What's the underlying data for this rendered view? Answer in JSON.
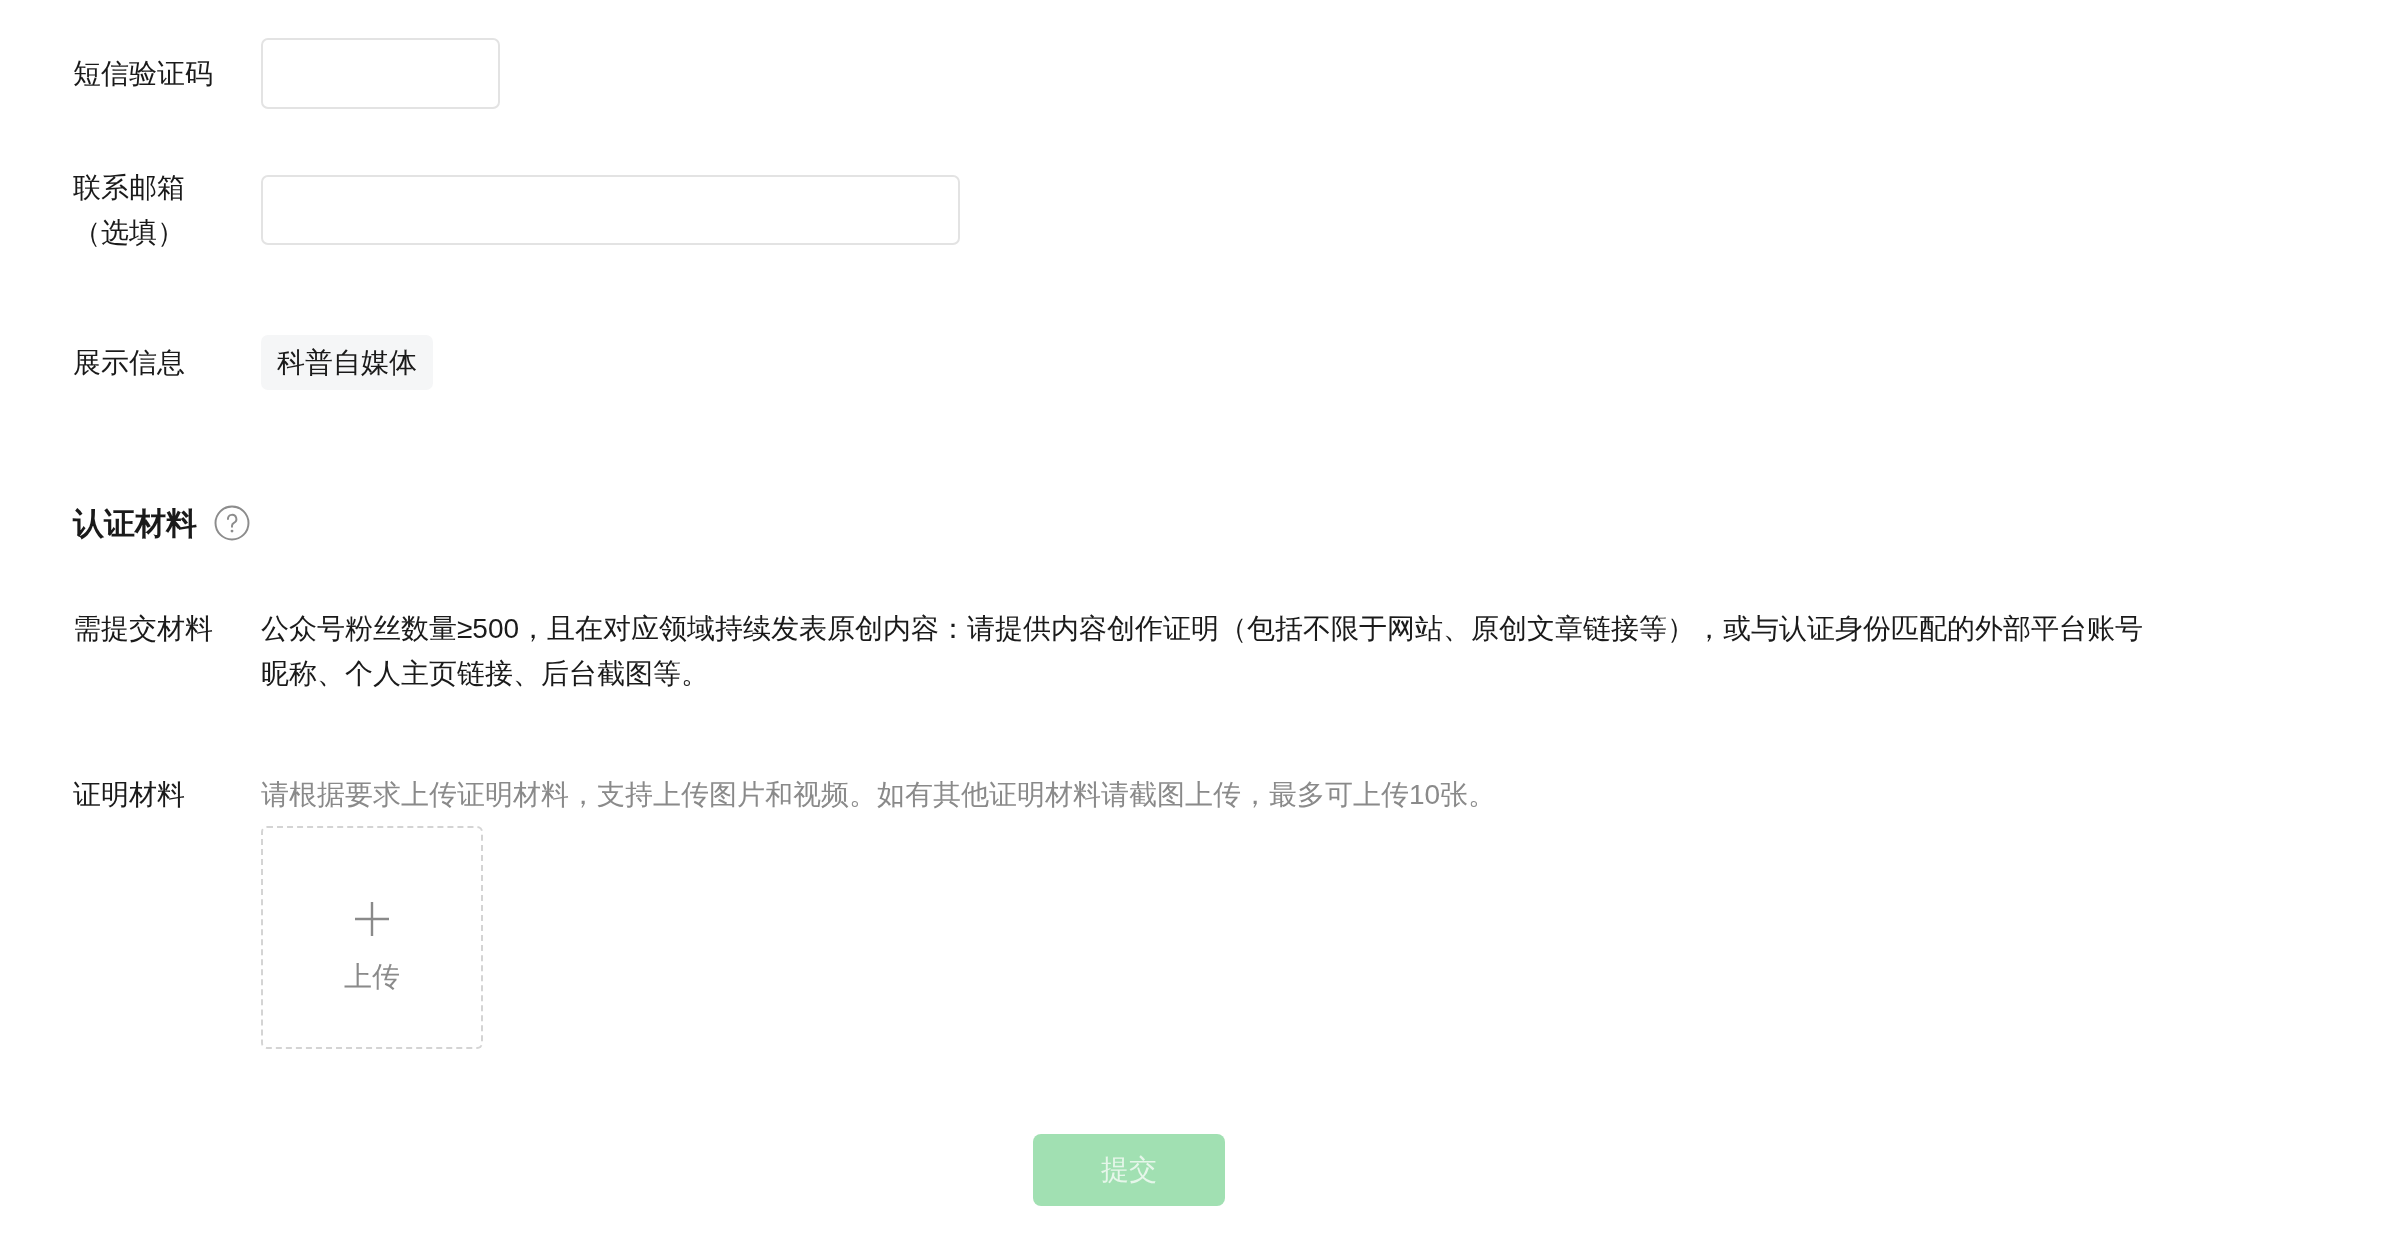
{
  "form": {
    "fields": [
      {
        "kind": "code",
        "label": "短信验证码"
      },
      {
        "kind": "text",
        "label": "联系邮箱（选填）"
      },
      {
        "kind": "tag",
        "label": "展示信息",
        "value": "科普自媒体"
      }
    ]
  },
  "certification": {
    "title": "认证材料",
    "requirements": {
      "label": "需提交材料",
      "text": "公众号粉丝数量≥500，且在对应领域持续发表原创内容：请提供内容创作证明（包括不限于网站、原创文章链接等），或与认证身份匹配的外部平台账号昵称、个人主页链接、后台截图等。"
    },
    "proof": {
      "label": "证明材料",
      "hint": "请根据要求上传证明材料，支持上传图片和视频。如有其他证明材料请截图上传，最多可上传10张。",
      "upload_label": "上传"
    }
  },
  "submit": {
    "label": "提交",
    "disabled": true
  }
}
